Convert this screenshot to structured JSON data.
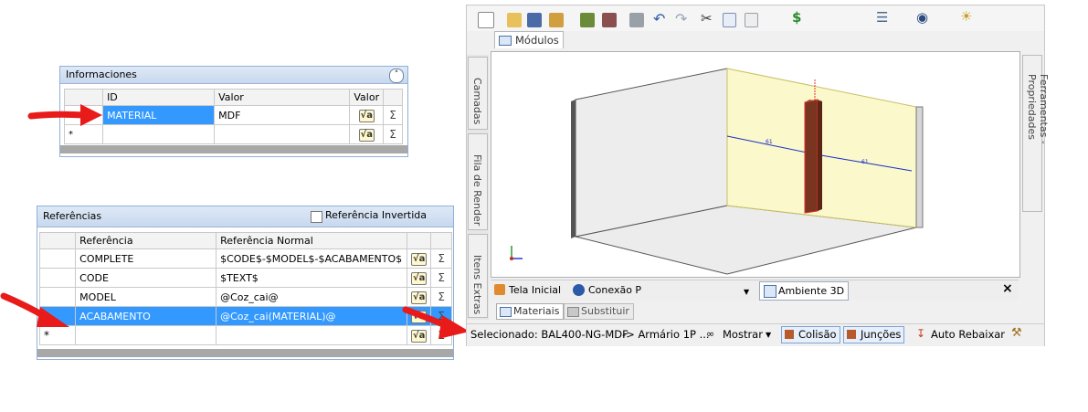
{
  "info_panel": {
    "title": "Informaciones",
    "columns": [
      "ID",
      "Valor",
      "Valor"
    ],
    "rows": [
      {
        "id": "MATERIAL",
        "valor": "MDF"
      },
      {
        "id": "",
        "valor": ""
      }
    ],
    "new_row_marker": "*",
    "sigma": "Σ",
    "sqrt": "√a"
  },
  "ref_panel": {
    "title": "Referências",
    "invert_label": "Referência Invertida",
    "columns": [
      "Referência",
      "Referência Normal"
    ],
    "rows": [
      {
        "ref": "COMPLETE",
        "normal": "$CODE$-$MODEL$-$ACABAMENTO$"
      },
      {
        "ref": "CODE",
        "normal": "$TEXT$"
      },
      {
        "ref": "MODEL",
        "normal": "@Coz_cai@"
      },
      {
        "ref": "ACABAMENTO",
        "normal": "@Coz_cai(MATERIAL)@"
      },
      {
        "ref": "",
        "normal": ""
      }
    ],
    "new_row_marker": "*",
    "sigma": "Σ",
    "sqrt": "√a"
  },
  "app": {
    "modules_tab": "Módulos",
    "side_tabs_left": [
      "Camadas",
      "Fila de Render",
      "Itens Extras"
    ],
    "side_tab_right": "Ferramentas - Propriedades",
    "viewport_tabs": [
      "Tela Inicial",
      "Conexão P",
      "Ambiente 3D"
    ],
    "close_symbol": "×",
    "bottom_tabs": [
      "Materiais",
      "Substituir"
    ],
    "status": {
      "selected": "Selecionado: BAL400-NG-MDF",
      "path": "-> Armário 1P ...",
      "show": "Mostrar",
      "collision": "Colisão",
      "joints": "Junções",
      "auto_lower": "Auto Rebaixar"
    },
    "dimension_labels": [
      "61",
      "61"
    ],
    "colors": {
      "panel_border": "#8fb0d8",
      "selection": "#3399ff",
      "arrow": "#e81a1a",
      "wall_yellow": "#fbf8cc",
      "column": "#8b3a20"
    }
  }
}
